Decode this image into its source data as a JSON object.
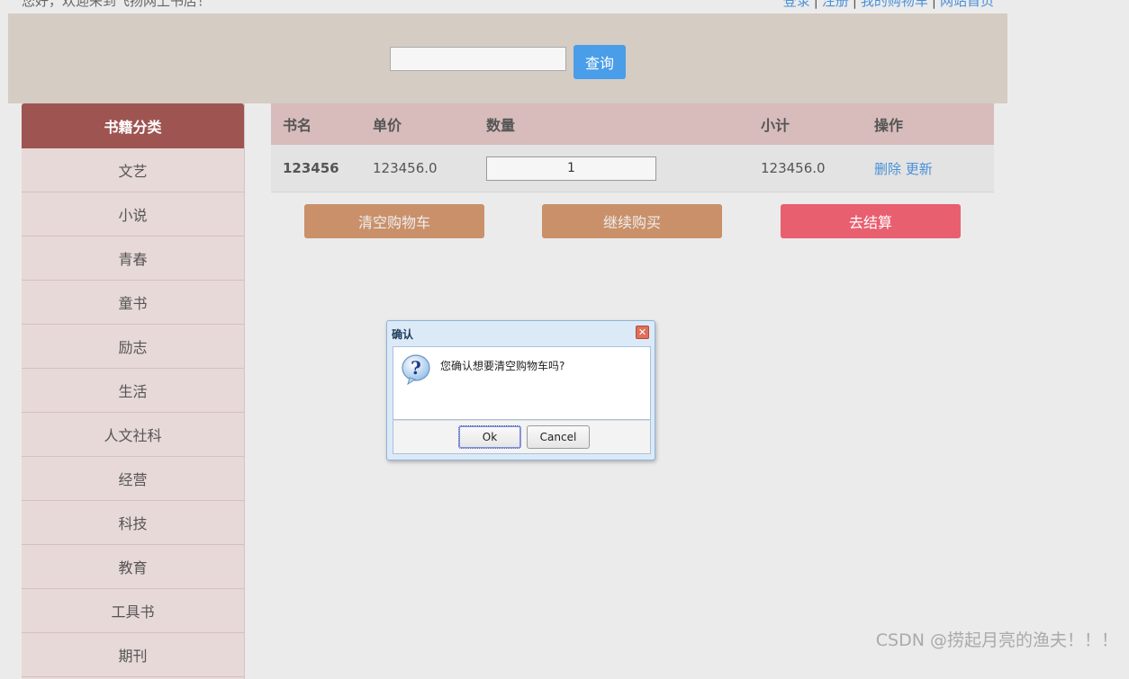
{
  "header": {
    "welcome": "您好，欢迎来到飞扬网上书店！",
    "links": [
      "登录",
      "注册",
      "我的购物车",
      "网站首页"
    ]
  },
  "search": {
    "value": "",
    "button": "查询"
  },
  "sidebar": {
    "title": "书籍分类",
    "items": [
      "文艺",
      "小说",
      "青春",
      "童书",
      "励志",
      "生活",
      "人文社科",
      "经营",
      "科技",
      "教育",
      "工具书",
      "期刊"
    ]
  },
  "cart": {
    "headers": [
      "书名",
      "单价",
      "数量",
      "小计",
      "操作"
    ],
    "rows": [
      {
        "name": "123456",
        "price": "123456.0",
        "quantity": "1",
        "subtotal": "123456.0",
        "delete": "删除",
        "update": "更新"
      }
    ],
    "buttons": {
      "clear": "清空购物车",
      "continue": "继续购买",
      "checkout": "去结算"
    }
  },
  "dialog": {
    "title": "确认",
    "message": "您确认想要清空购物车吗?",
    "ok": "Ok",
    "cancel": "Cancel",
    "icon": "question-icon"
  },
  "watermark": "CSDN @捞起月亮的渔夫！！！",
  "colors": {
    "banner": "#d5ccc4",
    "sidebar_header": "#9e5451",
    "cart_header": "#d7bcbb",
    "button_brown": "#c9906a",
    "button_checkout": "#e85f6f",
    "search_button": "#4a9de8",
    "link": "#4a90d9"
  }
}
